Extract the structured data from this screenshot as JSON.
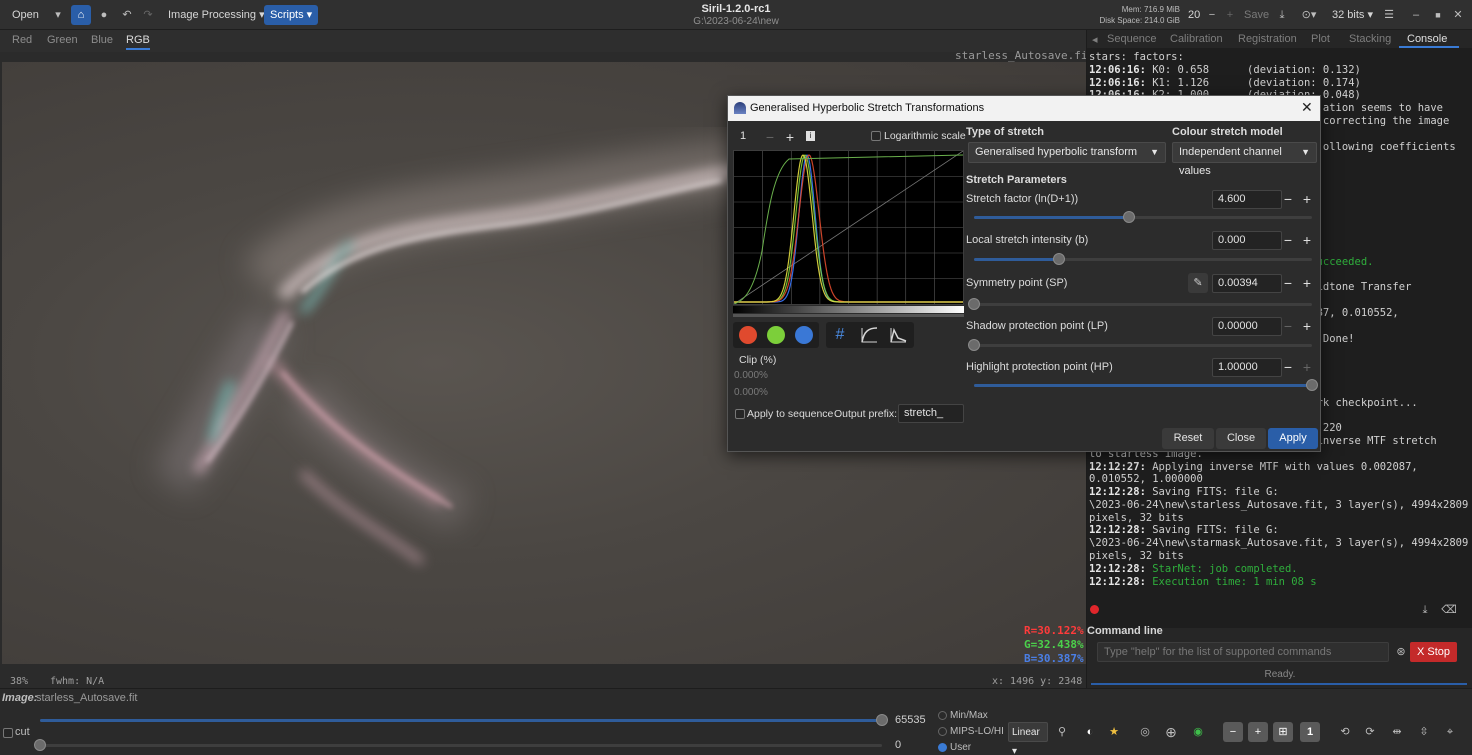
{
  "header": {
    "open_label": "Open",
    "image_processing_label": "Image Processing",
    "scripts_label": "Scripts",
    "title": "Siril-1.2.0-rc1",
    "subtitle": "G:\\2023-06-24\\new",
    "mem_label": "Mem: 716.9 MiB",
    "disk_label": "Disk Space: 214.0 GiB",
    "threads_value": "20",
    "save_label": "Save",
    "bits_label": "32 bits"
  },
  "channel_tabs": [
    "Red",
    "Green",
    "Blue",
    "RGB"
  ],
  "image": {
    "filename_top": "starless_Autosave.fit",
    "stat_r": "R=30.122%",
    "stat_g": "G=32.438%",
    "stat_b": "B=30.387%",
    "zoom": "38%",
    "fwhm": "fwhm: N/A",
    "coords": "x: 1496 y: 2348"
  },
  "bottom": {
    "image_label": "Image:",
    "image_name": "starless_Autosave.fit",
    "cut_label": "cut",
    "max_value": "65535",
    "min_value": "0",
    "radio_minmax": "Min/Max",
    "radio_mips": "MIPS-LO/HI",
    "radio_user": "User",
    "scale_mode": "Linear"
  },
  "right_tabs": [
    "Sequence",
    "Calibration",
    "Registration",
    "Plot",
    "Stacking",
    "Console"
  ],
  "console": [
    {
      "t": "",
      "text": "stars: factors:",
      "c": ""
    },
    {
      "t": "12:06:16:",
      "text": " K0: 0.658      (deviation: 0.132)",
      "c": ""
    },
    {
      "t": "12:06:16:",
      "text": " K1: 1.126      (deviation: 0.174)",
      "c": ""
    },
    {
      "t": "12:06:16:",
      "text": " K2: 1.000      (deviation: 0.048)",
      "c": ""
    },
    {
      "t": "",
      "text": "                                     ation seems to have",
      "c": ""
    },
    {
      "t": "",
      "text": "                                     correcting the image",
      "c": ""
    },
    {
      "t": "",
      "text": "",
      "c": ""
    },
    {
      "t": "",
      "text": "                                     ollowing coefficients",
      "c": ""
    },
    {
      "t": "",
      "text": "",
      "c": ""
    },
    {
      "t": "",
      "text": "",
      "c": ""
    },
    {
      "t": "",
      "text": "",
      "c": ""
    },
    {
      "t": "",
      "text": "",
      "c": ""
    },
    {
      "t": "",
      "text": "",
      "c": ""
    },
    {
      "t": "",
      "text": "",
      "c": ""
    },
    {
      "t": "",
      "text": "",
      "c": ""
    },
    {
      "t": "",
      "text": "",
      "c": ""
    },
    {
      "t": "",
      "text": "                                 n succeeded.",
      "c": "g"
    },
    {
      "t": "",
      "text": "                                 t...",
      "c": "g"
    },
    {
      "t": "",
      "text": "                                 g Midtone Transfer",
      "c": ""
    },
    {
      "t": "",
      "text": "",
      "c": ""
    },
    {
      "t": "",
      "text": "                                 02087, 0.010552,",
      "c": ""
    },
    {
      "t": "",
      "text": "",
      "c": ""
    },
    {
      "t": "",
      "text": "                                 ... Done!",
      "c": ""
    },
    {
      "t": "",
      "text": "",
      "c": ""
    },
    {
      "t": "",
      "text": "                                 3",
      "c": ""
    },
    {
      "t": "",
      "text": "",
      "c": ""
    },
    {
      "t": "",
      "text": "",
      "c": ""
    },
    {
      "t": "",
      "text": "                                 twork checkpoint...",
      "c": ""
    },
    {
      "t": "",
      "text": "",
      "c": ""
    },
    {
      "t": "",
      "text": "                                 es: 220",
      "c": ""
    },
    {
      "t": "",
      "text": "                                 ng inverse MTF stretch",
      "c": ""
    },
    {
      "t": "",
      "text": "to starless image.",
      "c": ""
    },
    {
      "t": "12:12:27:",
      "text": " Applying inverse MTF with values 0.002087,",
      "c": ""
    },
    {
      "t": "",
      "text": "0.010552, 1.000000",
      "c": ""
    },
    {
      "t": "12:12:28:",
      "text": " Saving FITS: file G:",
      "c": ""
    },
    {
      "t": "",
      "text": "\\2023-06-24\\new\\starless_Autosave.fit, 3 layer(s), 4994x2809",
      "c": ""
    },
    {
      "t": "",
      "text": "pixels, 32 bits",
      "c": ""
    },
    {
      "t": "12:12:28:",
      "text": " Saving FITS: file G:",
      "c": ""
    },
    {
      "t": "",
      "text": "\\2023-06-24\\new\\starmask_Autosave.fit, 3 layer(s), 4994x2809",
      "c": ""
    },
    {
      "t": "",
      "text": "pixels, 32 bits",
      "c": ""
    },
    {
      "t": "12:12:28:",
      "text": " StarNet: job completed.",
      "c": "g"
    },
    {
      "t": "12:12:28:",
      "text": " Execution time: 1 min 08 s",
      "c": "g"
    }
  ],
  "command": {
    "label": "Command line",
    "placeholder": "Type \"help\" for the list of supported commands",
    "stop_label": "X Stop",
    "status": "Ready."
  },
  "dialog": {
    "title": "Generalised Hyperbolic Stretch Transformations",
    "zoom_value": "1",
    "log_scale_label": "Logarithmic scale",
    "type_heading": "Type of stretch",
    "type_value": "Generalised hyperbolic transform",
    "colour_heading": "Colour stretch model",
    "colour_value": "Independent channel values",
    "params_heading": "Stretch Parameters",
    "clip_label": "Clip (%)",
    "clip_low": "0.000%",
    "clip_high": "0.000%",
    "apply_seq_label": "Apply to sequence",
    "output_prefix_label": "Output prefix:",
    "output_prefix_value": "stretch_",
    "reset_label": "Reset",
    "close_label": "Close",
    "apply_label": "Apply",
    "params": [
      {
        "label": "Stretch factor (ln(D+1))",
        "value": "4.600",
        "pos": 0.46
      },
      {
        "label": "Local stretch intensity (b)",
        "value": "0.000",
        "pos": 0.25
      },
      {
        "label": "Symmetry point (SP)",
        "value": "0.00394",
        "pos": 0.0
      },
      {
        "label": "Shadow protection point (LP)",
        "value": "0.00000",
        "pos": 0.0
      },
      {
        "label": "Highlight protection point (HP)",
        "value": "1.00000",
        "pos": 1.0
      }
    ]
  },
  "colors": {
    "accent": "#2a5ea8",
    "red_channel": "#e04a2e",
    "green_channel": "#7ccf3a",
    "blue_channel": "#3a78d6",
    "stop_button": "#c42a2a",
    "console_green": "#2fae3c"
  }
}
